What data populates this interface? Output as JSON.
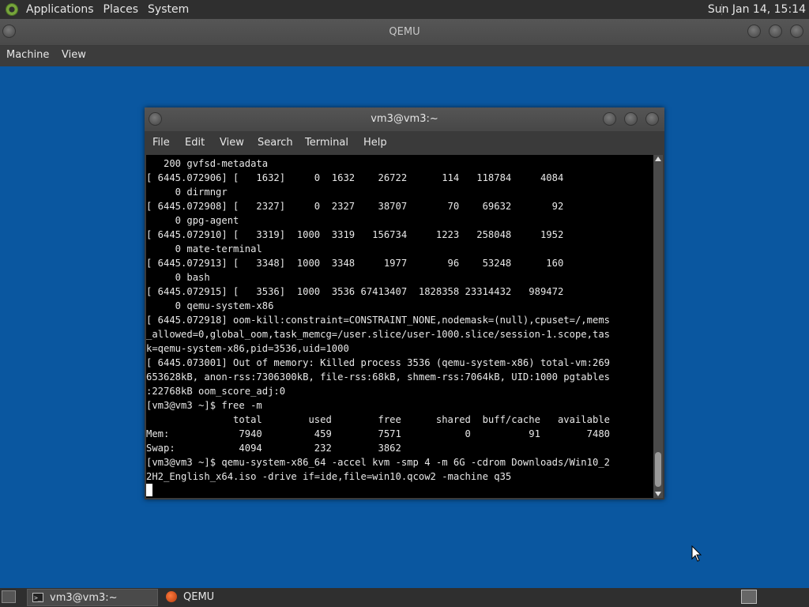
{
  "top_panel": {
    "menus": [
      "Applications",
      "Places",
      "System"
    ],
    "clock": "Sun Jan 14, 15:14"
  },
  "qemu": {
    "title": "QEMU",
    "menus": [
      "Machine",
      "View"
    ]
  },
  "terminal": {
    "title": "vm3@vm3:~",
    "menus": [
      "File",
      "Edit",
      "View",
      "Search",
      "Terminal",
      "Help"
    ],
    "lines": [
      "   200 gvfsd-metadata",
      "[ 6445.072906] [   1632]     0  1632    26722      114   118784     4084",
      "     0 dirmngr",
      "[ 6445.072908] [   2327]     0  2327    38707       70    69632       92",
      "     0 gpg-agent",
      "[ 6445.072910] [   3319]  1000  3319   156734     1223   258048     1952",
      "     0 mate-terminal",
      "[ 6445.072913] [   3348]  1000  3348     1977       96    53248      160",
      "     0 bash",
      "[ 6445.072915] [   3536]  1000  3536 67413407  1828358 23314432   989472",
      "     0 qemu-system-x86",
      "[ 6445.072918] oom-kill:constraint=CONSTRAINT_NONE,nodemask=(null),cpuset=/,mems",
      "_allowed=0,global_oom,task_memcg=/user.slice/user-1000.slice/session-1.scope,tas",
      "k=qemu-system-x86,pid=3536,uid=1000",
      "[ 6445.073001] Out of memory: Killed process 3536 (qemu-system-x86) total-vm:269",
      "653628kB, anon-rss:7306300kB, file-rss:68kB, shmem-rss:7064kB, UID:1000 pgtables",
      ":22768kB oom_score_adj:0",
      "[vm3@vm3 ~]$ free -m",
      "               total        used        free      shared  buff/cache   available",
      "Mem:            7940         459        7571           0          91        7480",
      "Swap:           4094         232        3862",
      "[vm3@vm3 ~]$ qemu-system-x86_64 -accel kvm -smp 4 -m 6G -cdrom Downloads/Win10_2",
      "2H2_English_x64.iso -drive if=ide,file=win10.qcow2 -machine q35"
    ]
  },
  "taskbar": {
    "items": [
      {
        "label": "vm3@vm3:~",
        "icon": "terminal-icon",
        "active": true
      },
      {
        "label": "QEMU",
        "icon": "qemu-icon",
        "active": false
      }
    ]
  }
}
